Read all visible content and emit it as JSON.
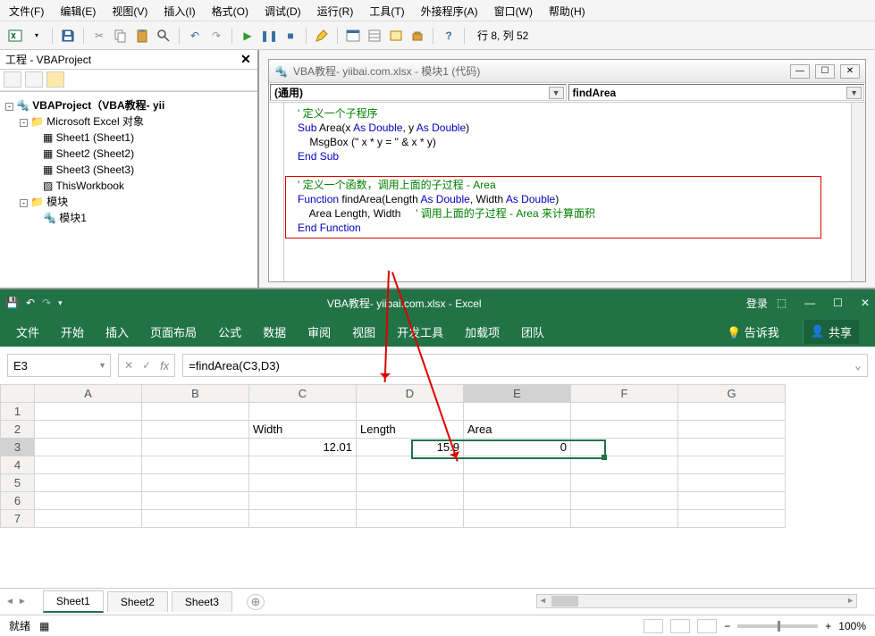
{
  "vba": {
    "menu": [
      "文件(F)",
      "编辑(E)",
      "视图(V)",
      "插入(I)",
      "格式(O)",
      "调试(D)",
      "运行(R)",
      "工具(T)",
      "外接程序(A)",
      "窗口(W)",
      "帮助(H)"
    ],
    "cursor": "行 8, 列 52",
    "project_panel_title": "工程 - VBAProject",
    "tree": {
      "root": "VBAProject（VBA教程-  yii",
      "excel_objs": "Microsoft Excel 对象",
      "sheets": [
        "Sheet1 (Sheet1)",
        "Sheet2 (Sheet2)",
        "Sheet3 (Sheet3)"
      ],
      "workbook": "ThisWorkbook",
      "modules_folder": "模块",
      "module": "模块1"
    },
    "code_title": "VBA教程-  yiibai.com.xlsx - 模块1 (代码)",
    "dd_left": "(通用)",
    "dd_right": "findArea",
    "code_lines": [
      {
        "cls": "c-com",
        "t": "   ' 定义一个子程序"
      },
      {
        "html": "   <span class='c-kw'>Sub</span> Area(x <span class='c-kw'>As Double</span>, y <span class='c-kw'>As Double</span>)"
      },
      {
        "html": "       MsgBox (\" x * y = \" & x * y)"
      },
      {
        "html": "   <span class='c-kw'>End Sub</span>"
      },
      {
        "t": ""
      },
      {
        "html": "   <span class='c-com'>' 定义一个函数，调用上面的子过程 - Area</span>"
      },
      {
        "html": "   <span class='c-kw'>Function</span> findArea(Length <span class='c-kw'>As Double</span>, Width <span class='c-kw'>As Double</span>)"
      },
      {
        "html": "       Area Length, Width     <span class='c-com'>' 调用上面的子过程 - Area 来计算面积</span>"
      },
      {
        "html": "   <span class='c-kw'>End Function</span>"
      }
    ]
  },
  "excel": {
    "title": "VBA教程-  yiibai.com.xlsx  -  Excel",
    "login": "登录",
    "ribbon": [
      "文件",
      "开始",
      "插入",
      "页面布局",
      "公式",
      "数据",
      "审阅",
      "视图",
      "开发工具",
      "加载项",
      "团队"
    ],
    "tell_me": "告诉我",
    "share": "共享",
    "name_box": "E3",
    "formula": "=findArea(C3,D3)",
    "columns": [
      "A",
      "B",
      "C",
      "D",
      "E",
      "F",
      "G"
    ],
    "grid": {
      "r2": {
        "C": "Width",
        "D": "Length",
        "E": "Area"
      },
      "r3": {
        "C": "12.01",
        "D": "15.9",
        "E": "0"
      }
    },
    "sheet_tabs": [
      "Sheet1",
      "Sheet2",
      "Sheet3"
    ],
    "active_tab": 0,
    "status_ready": "就绪",
    "zoom": "100%"
  }
}
